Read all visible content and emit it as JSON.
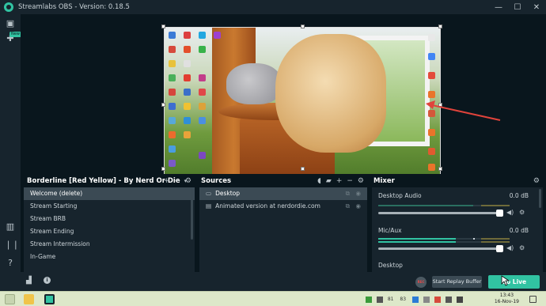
{
  "app": {
    "title": "Streamlabs OBS - Version: 0.18.5",
    "window_controls": [
      "—",
      "☐",
      "✕"
    ]
  },
  "sidebar": {
    "new_badge": "New",
    "icons": [
      "studio-icon",
      "themes-icon",
      "clip-icon",
      "help-icon",
      "settings-icon"
    ]
  },
  "scenes": {
    "collection_name": "Borderline [Red Yellow] - By Nerd Or Die",
    "items": [
      "Welcome (delete)",
      "Stream Starting",
      "Stream BRB",
      "Stream Ending",
      "Stream Intermission",
      "In-Game"
    ],
    "selected_index": 0
  },
  "sources": {
    "title": "Sources",
    "items": [
      "Desktop",
      "Animated version at nerdordie.com"
    ],
    "selected_index": 0
  },
  "mixer": {
    "title": "Mixer",
    "channels": [
      {
        "name": "Desktop Audio",
        "db": "0.0 dB"
      },
      {
        "name": "Mic/Aux",
        "db": "0.0 dB"
      },
      {
        "name": "Desktop",
        "db": ""
      }
    ]
  },
  "footer": {
    "rec_label": "REC",
    "replay_label": "Start Replay Buffer",
    "golive_label": "Go Live"
  },
  "taskbar": {
    "time": "13:43",
    "date": "16-Nov-19",
    "tray_numbers": [
      "81",
      "83"
    ]
  },
  "colors": {
    "accent": "#31c3a2",
    "panel": "#17242d",
    "background": "#09161d",
    "arrow": "#e0433b"
  }
}
